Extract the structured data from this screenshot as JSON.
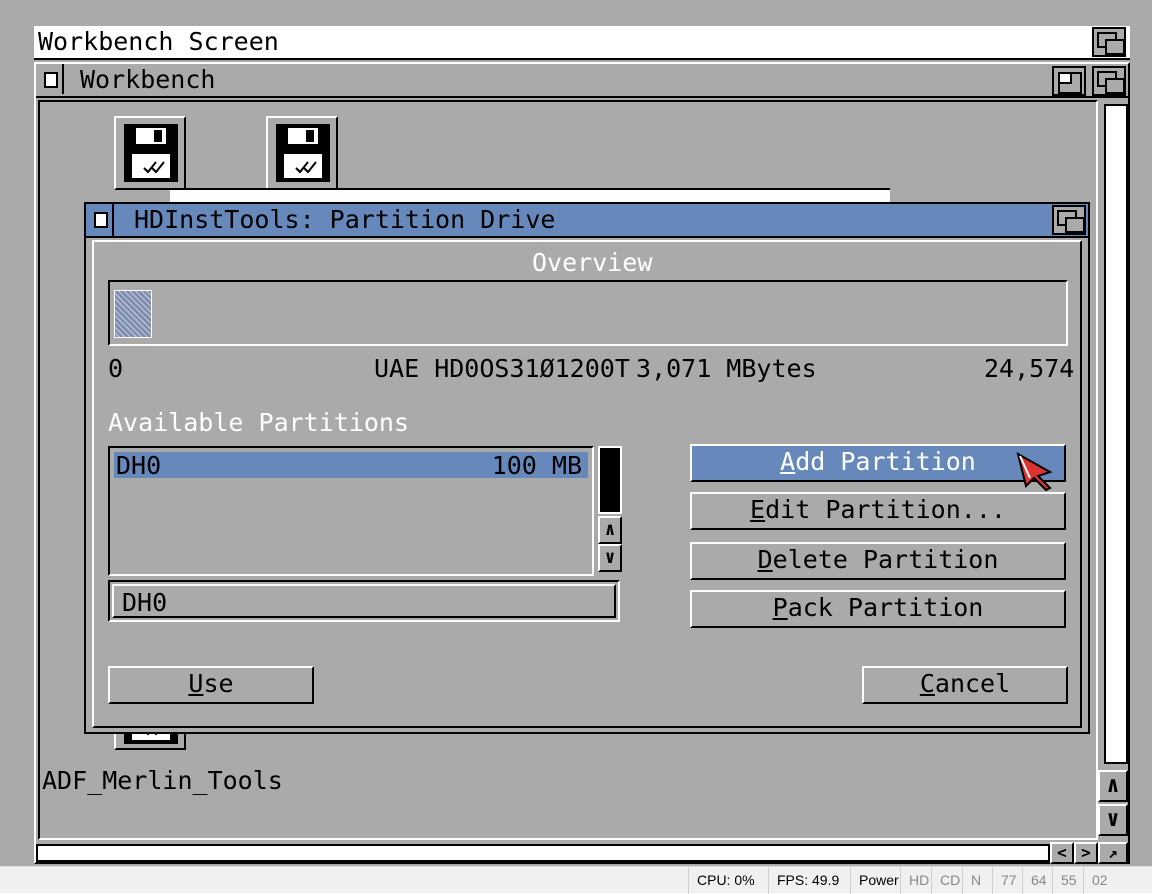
{
  "screen": {
    "title": "Workbench Screen"
  },
  "workbench": {
    "title": "Workbench",
    "icons": [
      {
        "label": ""
      },
      {
        "label": ""
      },
      {
        "label": "ADF_Merlin_Tools"
      }
    ]
  },
  "dialog": {
    "title": "HDInstTools: Partition Drive",
    "overview_label": "Overview",
    "scale": {
      "start": "0",
      "drive": "UAE HD0OS31Ø1200T",
      "size": "3,071 MBytes",
      "end": "24,574"
    },
    "used_fraction": 0.04,
    "available_label": "Available Partitions",
    "partitions": [
      {
        "name": "DH0",
        "size": "100 MB"
      }
    ],
    "name_field": "DH0",
    "buttons": {
      "add": {
        "hot": "A",
        "rest": "dd Partition"
      },
      "edit": {
        "hot": "E",
        "rest": "dit Partition..."
      },
      "delete": {
        "hot": "D",
        "rest": "elete Partition"
      },
      "pack": {
        "hot": "P",
        "rest": "ack Partition"
      },
      "use": {
        "hot": "U",
        "rest": "se"
      },
      "cancel": {
        "hot": "C",
        "rest": "ancel"
      }
    }
  },
  "statusbar": {
    "cpu": "CPU: 0%",
    "fps": "FPS: 49.9",
    "power": "Power",
    "hd": "HD",
    "cd": "CD",
    "n": "N",
    "d0": "77",
    "d1": "64",
    "d2": "55",
    "d3": "02"
  }
}
